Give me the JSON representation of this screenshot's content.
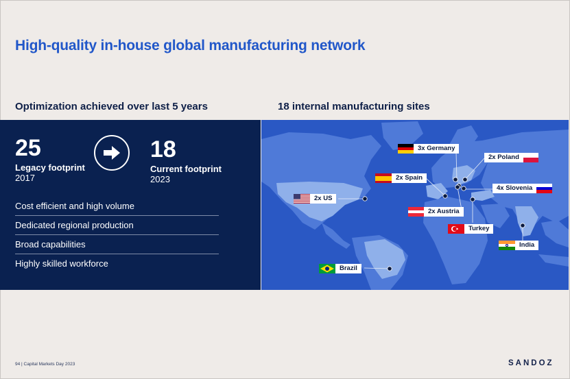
{
  "title": "High-quality in-house global manufacturing network",
  "left": {
    "heading": "Optimization achieved over last 5 years",
    "legacy": {
      "number": "25",
      "label": "Legacy footprint",
      "year": "2017"
    },
    "current": {
      "number": "18",
      "label": "Current footprint",
      "year": "2023"
    },
    "arrow_icon": "arrow-right-icon",
    "bullets": [
      "Cost efficient and high volume",
      "Dedicated regional production",
      "Broad capabilities",
      "Highly skilled workforce"
    ]
  },
  "right": {
    "heading": "18 internal manufacturing sites",
    "sites": {
      "germany": "3x Germany",
      "poland": "2x Poland",
      "spain": "2x Spain",
      "slovenia": "4x Slovenia",
      "us": "2x US",
      "austria": "2x Austria",
      "turkey": "Turkey",
      "india": "India",
      "brazil": "Brazil"
    }
  },
  "footer": {
    "page": "94 | Capital Markets Day 2023",
    "logo": "SANDOZ"
  },
  "colors": {
    "title_blue": "#2157c9",
    "navy_panel": "#0a2150",
    "map_ocean": "#2a58c4",
    "map_land": "#4f7ad8",
    "highlight_land": "#8fb0ea"
  }
}
